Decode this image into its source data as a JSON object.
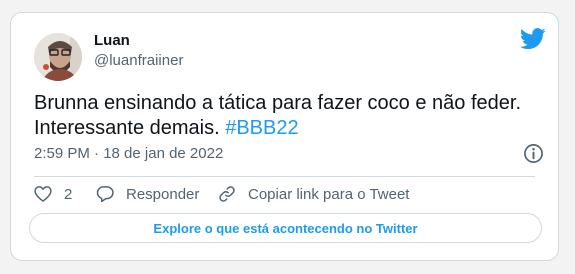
{
  "tweet": {
    "author_name": "Luan",
    "author_handle": "@luanfraiiner",
    "text_main": "Brunna ensinando a tática para fazer coco e não feder. Interessante demais.",
    "hashtag": "#BBB22",
    "timestamp": "2:59 PM · 18 de jan de 2022"
  },
  "actions": {
    "like_count": "2",
    "reply_label": "Responder",
    "copy_label": "Copiar link para o Tweet"
  },
  "explore_label": "Explore o que está acontecendo no Twitter",
  "icons": {
    "brand": "twitter-bird-icon",
    "info": "info-icon",
    "like": "heart-icon",
    "reply": "speech-bubble-icon",
    "copy": "link-icon"
  },
  "colors": {
    "accent": "#1d9bf0",
    "text": "#0f1419",
    "secondary": "#536471",
    "border": "#cfd9de"
  }
}
